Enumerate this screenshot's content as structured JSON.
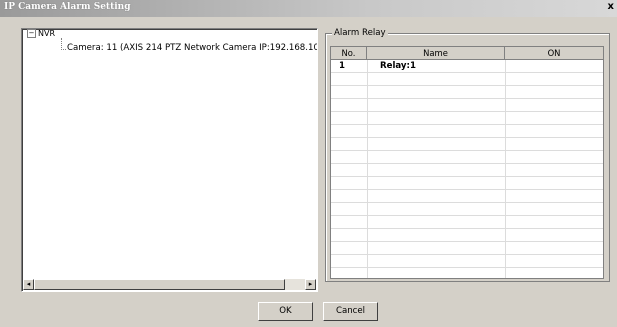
{
  "window": {
    "title": "IP Camera Alarm Setting",
    "close_glyph": "x"
  },
  "tree": {
    "expander_glyph": "−",
    "root_label": "NVR",
    "child_label": "Camera: 11 (AXIS 214 PTZ Network Camera IP:192.168.10"
  },
  "scroll": {
    "left_glyph": "◂",
    "right_glyph": "▸"
  },
  "alarm_relay": {
    "group_label": "Alarm Relay",
    "columns": [
      "No.",
      "Name",
      "ON"
    ],
    "rows": [
      {
        "no": "1",
        "name": "Relay:1",
        "on": ""
      }
    ]
  },
  "buttons": {
    "ok": "OK",
    "cancel": "Cancel"
  }
}
